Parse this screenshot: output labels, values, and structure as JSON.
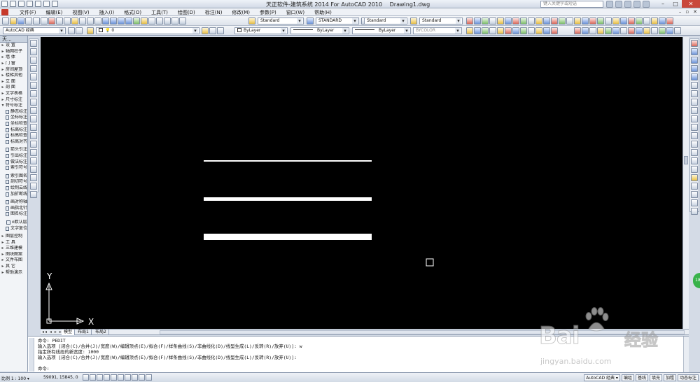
{
  "titlebar": {
    "title": "天正软件-建筑系统 2014  For AutoCAD 2010",
    "document": "Drawing1.dwg",
    "search_placeholder": "键入关键字或短语"
  },
  "menu": {
    "items": [
      "文件(F)",
      "编辑(E)",
      "视图(V)",
      "插入(I)",
      "格式(O)",
      "工具(T)",
      "绘图(D)",
      "标注(N)",
      "修改(M)",
      "参数(P)",
      "窗口(W)",
      "帮助(H)"
    ]
  },
  "toolbar1": {
    "text_style": "Standard",
    "dim_style": "STANDARD",
    "table_style": "Standard",
    "mleader_style": "Standard"
  },
  "toolbar2": {
    "workspace": "AutoCAD 经典",
    "layer": "0",
    "color": "ByLayer",
    "linetype": "ByLayer",
    "lineweight": "ByLayer",
    "plotstyle": "BYCOLOR"
  },
  "palette": {
    "header": "天...",
    "items": [
      {
        "marker": "▸",
        "label": "设    置"
      },
      {
        "marker": "▸",
        "label": "轴网柱子"
      },
      {
        "marker": "▸",
        "label": "墙    体"
      },
      {
        "marker": "▸",
        "label": "门    窗"
      },
      {
        "marker": "▸",
        "label": "房间屋顶"
      },
      {
        "marker": "▸",
        "label": "楼梯其他"
      },
      {
        "marker": "▸",
        "label": "立    面"
      },
      {
        "marker": "▸",
        "label": "剖    面"
      },
      {
        "marker": "▸",
        "label": "文字表格"
      },
      {
        "marker": "▸",
        "label": "尺寸标注"
      },
      {
        "marker": "▾",
        "label": "符号标注"
      },
      {
        "marker": "",
        "label": "静态标注"
      },
      {
        "marker": "",
        "label": "坐标标注"
      },
      {
        "marker": "",
        "label": "坐标检查"
      },
      {
        "marker": "",
        "label": "标高标注"
      },
      {
        "marker": "",
        "label": "标高检查"
      },
      {
        "marker": "",
        "label": "标高对齐"
      },
      {
        "marker": "",
        "label": ""
      },
      {
        "marker": "",
        "label": "箭头引注"
      },
      {
        "marker": "",
        "label": "引出标注"
      },
      {
        "marker": "",
        "label": "做法标注"
      },
      {
        "marker": "",
        "label": "索引符号"
      },
      {
        "marker": "",
        "label": ""
      },
      {
        "marker": "",
        "label": "索引图名"
      },
      {
        "marker": "",
        "label": "剖切符号"
      },
      {
        "marker": "",
        "label": "绘制云线"
      },
      {
        "marker": "",
        "label": "加折断线"
      },
      {
        "marker": "",
        "label": ""
      },
      {
        "marker": "",
        "label": "画对称轴"
      },
      {
        "marker": "",
        "label": "画指北针"
      },
      {
        "marker": "",
        "label": "图名标注"
      },
      {
        "marker": "",
        "label": ""
      },
      {
        "marker": "",
        "label": "o默认层"
      },
      {
        "marker": "",
        "label": "文字复位"
      },
      {
        "marker": "",
        "label": ""
      },
      {
        "marker": "▸",
        "label": "图层控制"
      },
      {
        "marker": "▸",
        "label": "工    具"
      },
      {
        "marker": "▸",
        "label": "三维建模"
      },
      {
        "marker": "▸",
        "label": "图块图案"
      },
      {
        "marker": "▸",
        "label": "文件布图"
      },
      {
        "marker": "▸",
        "label": "其    它"
      },
      {
        "marker": "▸",
        "label": "帮助演示"
      }
    ]
  },
  "canvas": {
    "background": "#000000",
    "line_color": "#ffffff",
    "ucs_x_label": "X",
    "ucs_y_label": "Y"
  },
  "tabs": {
    "nav": "◂◂ ◂ ▸ ▸▸",
    "items": [
      "模型",
      "布局1",
      "布局2"
    ],
    "active": "模型"
  },
  "command": {
    "lines": [
      "命令:  PEDIT",
      "输入选项 [闭合(C)/合并(J)/宽度(W)/编辑顶点(E)/拟合(F)/样条曲线(S)/非曲线化(D)/线型生成(L)/反转(R)/放弃(U)]: w",
      "指定所有线段的新宽度: 1000",
      "输入选项 [闭合(C)/合并(J)/宽度(W)/编辑顶点(E)/拟合(F)/样条曲线(S)/非曲线化(D)/线型生成(L)/反转(R)/放弃(U)]:"
    ],
    "prompt": "命令:"
  },
  "status": {
    "scale": "比例 1 : 100 ▾",
    "coords": "59091, 15845, 0",
    "workspace": "AutoCAD 经典 ▾",
    "buttons": [
      "编组",
      "基线",
      "填充",
      "加粗",
      "动态标注"
    ]
  },
  "watermark": {
    "brand_latin": "Bai",
    "brand_cn": "经验",
    "url": "jingyan.baidu.com"
  }
}
